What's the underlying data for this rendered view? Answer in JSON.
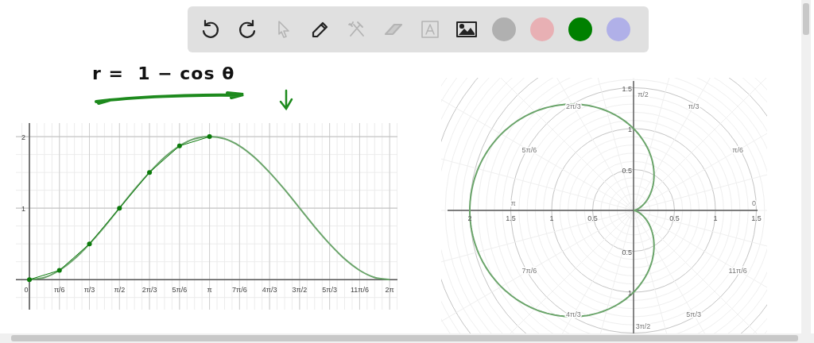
{
  "toolbar": {
    "tools": [
      {
        "kind": "undo",
        "disabled": false
      },
      {
        "kind": "redo",
        "disabled": false
      },
      {
        "kind": "select",
        "disabled": true
      },
      {
        "kind": "pen",
        "disabled": false
      },
      {
        "kind": "tools",
        "disabled": true
      },
      {
        "kind": "eraser",
        "disabled": true
      },
      {
        "kind": "text",
        "disabled": true
      },
      {
        "kind": "image",
        "disabled": false
      }
    ],
    "colors": [
      {
        "color": "#b0b0b0"
      },
      {
        "color": "#e8b0b4"
      },
      {
        "color": "#008000"
      },
      {
        "color": "#b0b0e8"
      }
    ]
  },
  "handwritten_note": "r =  1 − cos θ",
  "graph": {
    "chart_data": {
      "type": "line",
      "categories": [
        "0",
        null,
        "π/6",
        null,
        "π/3",
        null,
        "π/2",
        null,
        "2π/3",
        null,
        "5π/6",
        null,
        "π",
        null,
        "7π/6",
        null,
        "4π/3",
        null,
        "3π/2",
        null,
        "5π/3",
        null,
        "11π/6",
        null,
        "2π"
      ],
      "series": [
        {
          "color": "#6aa46a",
          "values": [
            0,
            0.03,
            0.13,
            0.29,
            0.5,
            0.74,
            1,
            1.26,
            1.5,
            1.71,
            1.87,
            1.97,
            2,
            1.97,
            1.87,
            1.71,
            1.5,
            1.26,
            1,
            0.74,
            0.5,
            0.29,
            0.13,
            0.03,
            0
          ]
        },
        {
          "color": "#0a7a0a",
          "marker": true,
          "values": [
            0,
            null,
            0.13,
            null,
            0.5,
            null,
            1,
            null,
            1.5,
            null,
            1.87,
            null,
            2,
            null,
            null,
            null,
            null,
            null,
            null,
            null,
            null,
            null,
            null,
            null,
            null
          ]
        }
      ],
      "ylim": [
        -0.42,
        2.19
      ],
      "grid": true,
      "yticks": [
        1,
        2
      ]
    }
  },
  "polar_plot": {
    "angle_labels": [
      "0",
      "π/6",
      "π/3",
      "π/2",
      "2π/3",
      "5π/6",
      "π",
      "7π/6",
      "4π/3",
      "3π/2",
      "5π/3",
      "11π/6"
    ],
    "x_axis_labels": [
      "2",
      "1.5",
      "1",
      "0.5",
      "0.5",
      "1",
      "1.5"
    ],
    "y_axis_labels": [
      "1.5",
      "1",
      "0.5",
      "0.5",
      "1"
    ]
  }
}
